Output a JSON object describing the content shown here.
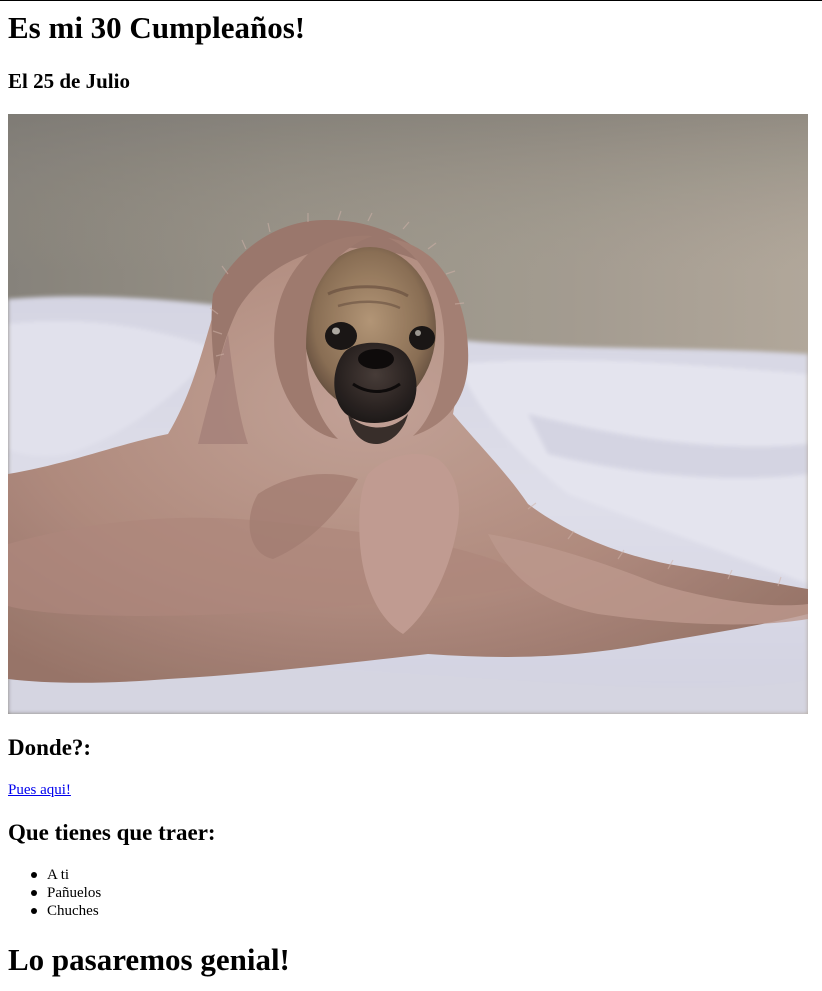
{
  "page": {
    "title": "Es mi 30 Cumpleaños!",
    "date": "El 25 de Julio",
    "photo": {
      "description_icon": "pug-in-blanket-photo"
    },
    "where_heading": "Donde?:",
    "where_link": "Pues aqui!",
    "bring_heading": "Que tienes que traer:",
    "bring_items": [
      {
        "label": "A ti"
      },
      {
        "label": "Pañuelos"
      },
      {
        "label": "Chuches"
      }
    ],
    "closing": "Lo pasaremos genial!"
  },
  "colors": {
    "link": "#0000ee",
    "text": "#000000",
    "background": "#ffffff"
  }
}
